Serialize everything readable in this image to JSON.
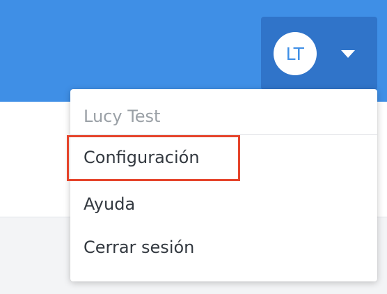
{
  "header": {
    "background_color": "#3f8fe6",
    "user_button_color": "#3074c9"
  },
  "user": {
    "initials": "LT",
    "name": "Lucy Test"
  },
  "icons": {
    "dropdown": "caret-down-icon"
  },
  "menu": {
    "items": [
      {
        "label": "Configuración",
        "highlighted": true
      },
      {
        "label": "Ayuda"
      },
      {
        "label": "Cerrar sesión"
      }
    ]
  },
  "highlight": {
    "color": "#e5442b"
  }
}
